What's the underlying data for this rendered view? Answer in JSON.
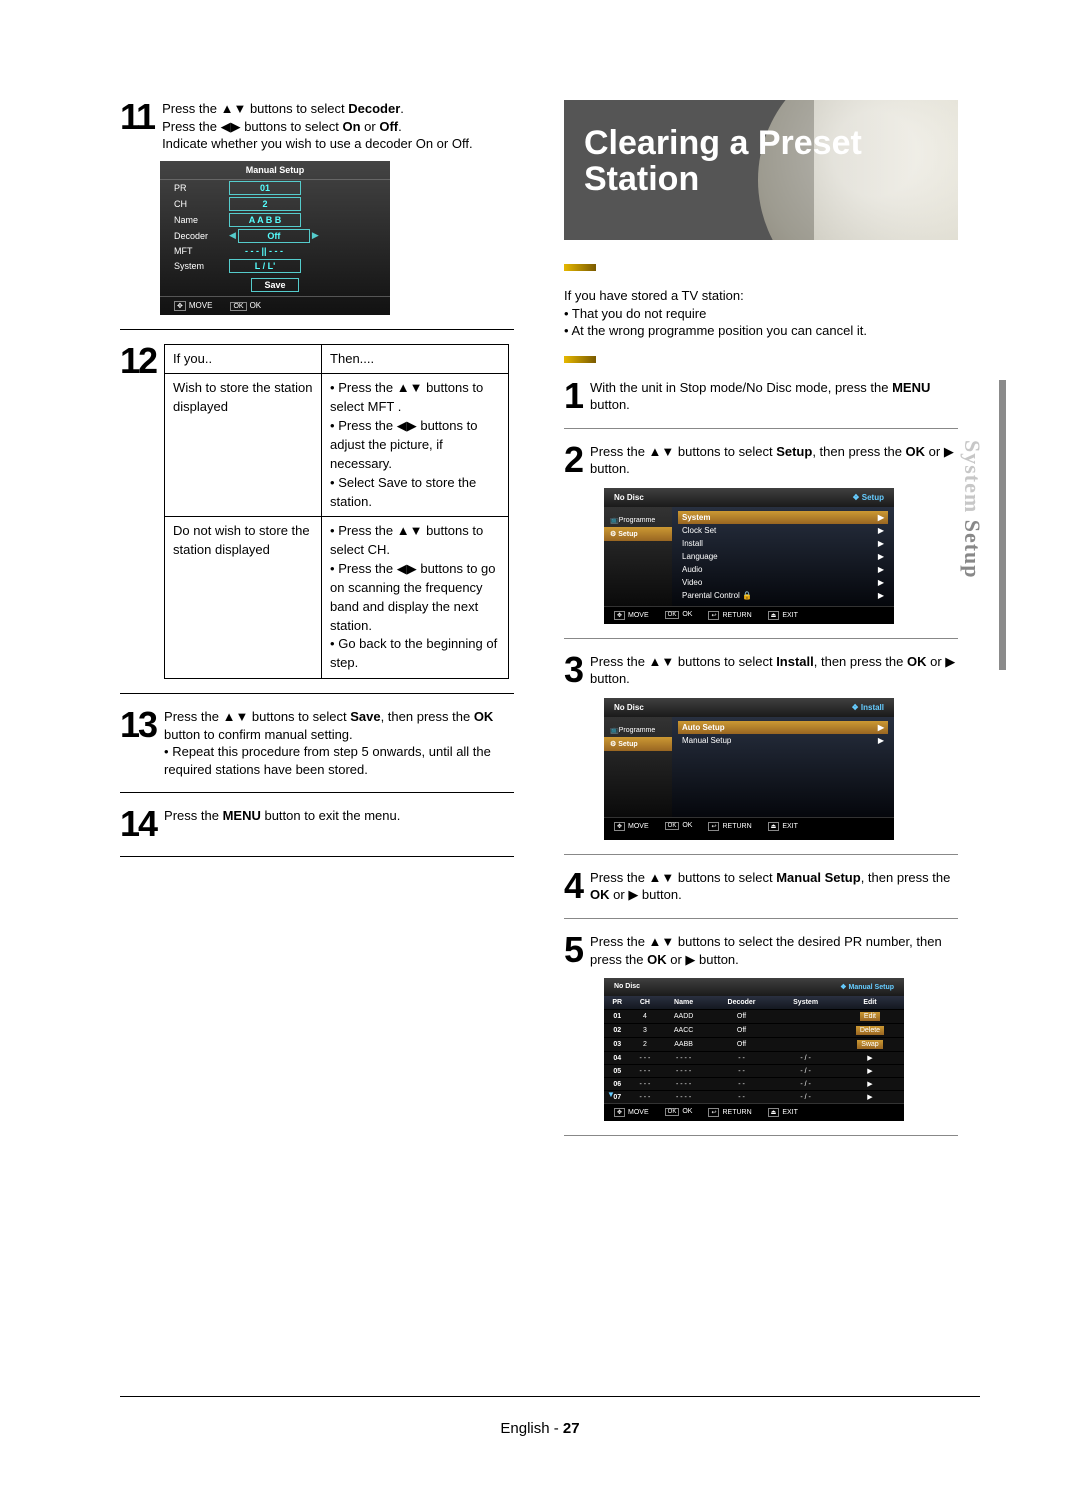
{
  "left": {
    "step11": {
      "num": "11",
      "line1a": "Press the ",
      "line1b": " buttons to select ",
      "decoder": "Decoder",
      "line2a": "Press the ",
      "line2b": " buttons to select ",
      "onoff": "On",
      "or": " or ",
      "off": "Off",
      "line3": "Indicate whether you wish to use a decoder On or Off."
    },
    "osd11": {
      "title": "Manual Setup",
      "rows": [
        {
          "l": "PR",
          "v": "01"
        },
        {
          "l": "CH",
          "v": "2"
        },
        {
          "l": "Name",
          "v": "A A B B"
        },
        {
          "l": "Decoder",
          "v": "Off"
        },
        {
          "l": "MFT",
          "v": "- - - || - - -"
        },
        {
          "l": "System",
          "v": "L / L'"
        }
      ],
      "save": "Save",
      "move": "MOVE",
      "ok": "OK"
    },
    "step12": {
      "num": "12",
      "h1": "If you..",
      "h2": "Then....",
      "r1a": "Wish to store the station displayed",
      "r1b": "• Press the ▲▼ buttons to select MFT .\n• Press the ◀▶ buttons to adjust the picture, if necessary.\n• Select Save to store the station.",
      "r2a": "Do not wish to store the station displayed",
      "r2b": "• Press the ▲▼ buttons to select CH.\n• Press the ◀▶ buttons to go on scanning the frequency band and display the next station.\n• Go back to the beginning of step."
    },
    "step13": {
      "num": "13",
      "t1": "Press the ▲▼ buttons to select ",
      "save": "Save",
      "t2": ", then press the ",
      "ok": "OK",
      "t3": " button to confirm manual setting.",
      "bul": "• Repeat this procedure from step 5 onwards, until all the required stations have been stored."
    },
    "step14": {
      "num": "14",
      "t1": "Press the ",
      "menu": "MENU",
      "t2": " button to exit the menu."
    }
  },
  "right": {
    "title": "Clearing a Preset Station",
    "intro": {
      "l1": "If you have stored a TV station:",
      "l2": "• That you do not require",
      "l3": "• At the wrong programme position you can cancel it."
    },
    "s1": {
      "num": "1",
      "t1": "With the unit in Stop mode/No Disc mode, press the ",
      "menu": "MENU",
      "t2": " button."
    },
    "s2": {
      "num": "2",
      "t1": "Press the ▲▼ buttons to select ",
      "setup": "Setup",
      "t2": ", then press the ",
      "ok": "OK",
      "t3": " or ▶ button."
    },
    "osdSetup": {
      "nd": "No Disc",
      "tag": "❖  Setup",
      "side": [
        "Programme",
        "Setup"
      ],
      "items": [
        "System",
        "Clock Set",
        "Install",
        "Language",
        "Audio",
        "Video",
        "Parental Control"
      ],
      "move": "MOVE",
      "ok": "OK",
      "ret": "RETURN",
      "exit": "EXIT"
    },
    "s3": {
      "num": "3",
      "t1": "Press the ▲▼ buttons to select ",
      "install": "Install",
      "t2": ", then press the ",
      "ok": "OK",
      "t3": " or ▶ button."
    },
    "osdInstall": {
      "nd": "No Disc",
      "tag": "❖  Install",
      "side": [
        "Programme",
        "Setup"
      ],
      "items": [
        "Auto Setup",
        "Manual Setup"
      ],
      "move": "MOVE",
      "ok": "OK",
      "ret": "RETURN",
      "exit": "EXIT"
    },
    "s4": {
      "num": "4",
      "t1": "Press the ▲▼ buttons to select ",
      "ms": "Manual Setup",
      "t2": ", then press the ",
      "ok": "OK",
      "t3": " or ▶ button."
    },
    "s5": {
      "num": "5",
      "t1": "Press the ▲▼ buttons to select the desired PR number, then press the ",
      "ok": "OK",
      "t2": " or ▶ button."
    },
    "osdMS": {
      "nd": "No Disc",
      "tag": "❖  Manual Setup",
      "cols": [
        "PR",
        "CH",
        "Name",
        "Decoder",
        "System",
        "Edit"
      ],
      "rows": [
        {
          "pr": "01",
          "ch": "4",
          "nm": "AADD",
          "dc": "Off",
          "sy": "",
          "ed": "Edit"
        },
        {
          "pr": "02",
          "ch": "3",
          "nm": "AACC",
          "dc": "Off",
          "sy": "",
          "ed": "Delete"
        },
        {
          "pr": "03",
          "ch": "2",
          "nm": "AABB",
          "dc": "Off",
          "sy": "",
          "ed": "Swap"
        },
        {
          "pr": "04",
          "ch": "- - -",
          "nm": "- - - -",
          "dc": "- -",
          "sy": "- / -",
          "ed": "▶"
        },
        {
          "pr": "05",
          "ch": "- - -",
          "nm": "- - - -",
          "dc": "- -",
          "sy": "- / -",
          "ed": "▶"
        },
        {
          "pr": "06",
          "ch": "- - -",
          "nm": "- - - -",
          "dc": "- -",
          "sy": "- / -",
          "ed": "▶"
        },
        {
          "pr": "07",
          "ch": "- - -",
          "nm": "- - - -",
          "dc": "- -",
          "sy": "- / -",
          "ed": "▶"
        }
      ],
      "move": "MOVE",
      "ok": "OK",
      "ret": "RETURN",
      "exit": "EXIT"
    }
  },
  "sidetab": {
    "a": "System ",
    "b": "Setup"
  },
  "footer": {
    "lang": "English",
    "sep": " - ",
    "pg": "27"
  }
}
